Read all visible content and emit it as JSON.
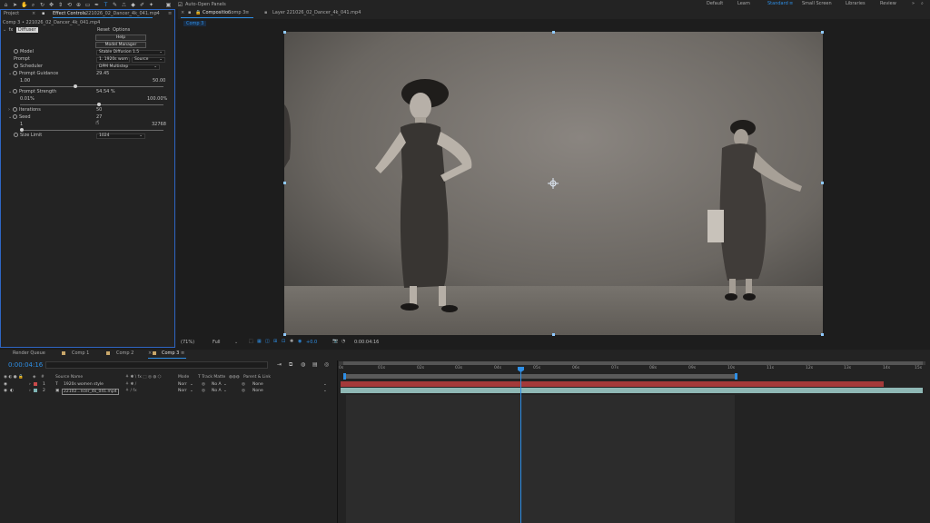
{
  "toolbar": {
    "auto_open": "Auto-Open Panels",
    "workspaces": [
      "Default",
      "Learn",
      "Standard",
      "Small Screen",
      "Libraries",
      "Review"
    ],
    "active_workspace": "Standard"
  },
  "left_panel": {
    "tab_project": "Project",
    "tab_effect": "Effect Controls",
    "tab_effect_file": "221026_02_Dancer_4k_041.mp4",
    "breadcrumb": "Comp 3 • 221026_02_Dancer_4k_041.mp4",
    "effect_name": "Diffuser",
    "reset": "Reset",
    "options": "Options",
    "help_btn": "Help",
    "model_manager_btn": "Model Manager",
    "params": {
      "model_label": "Model",
      "model_value": "Stable Diffusion 1.5",
      "prompt_label": "Prompt",
      "prompt_value": "1. 1920s wom",
      "prompt_source": "Source",
      "scheduler_label": "Scheduler",
      "scheduler_value": "DPM Multistep",
      "guidance_label": "Prompt Guidance",
      "guidance_value": "29.45",
      "guidance_min": "1.00",
      "guidance_max": "50.00",
      "strength_label": "Prompt Strength",
      "strength_value": "54.54 %",
      "strength_min": "0.01%",
      "strength_max": "100.00%",
      "iterations_label": "Iterations",
      "iterations_value": "50",
      "seed_label": "Seed",
      "seed_value": "27",
      "seed_min": "1",
      "seed_max": "32768",
      "size_label": "Size Limit",
      "size_value": "1024"
    }
  },
  "comp_panel": {
    "tab_comp": "Composition",
    "tab_comp_name": "Comp 3",
    "tab_layer": "Layer 221026_02_Dancer_4k_041.mp4",
    "subtab": "Comp 3",
    "zoom": "(71%)",
    "resolution": "Full",
    "exposure": "+0.0",
    "timecode": "0:00:04:16"
  },
  "timeline": {
    "tabs": [
      "Render Queue",
      "Comp 1",
      "Comp 2",
      "Comp 3"
    ],
    "active_tab": "Comp 3",
    "timecode": "0:00:04:16",
    "search_placeholder": "",
    "columns": {
      "source": "Source Name",
      "mode": "Mode",
      "track_matte": "T  Track Matte",
      "parent": "Parent & Link"
    },
    "layers": [
      {
        "num": "1",
        "type": "T",
        "name": "1920s women style",
        "mode": "Norr",
        "matte": "No A",
        "parent": "None",
        "color": "#c94a4a"
      },
      {
        "num": "2",
        "type": "",
        "name": "22102...ncer_4k_041.mp4",
        "mode": "Norr",
        "matte": "No A",
        "parent": "None",
        "color": "#7fb5b5"
      }
    ],
    "ruler": [
      "0s",
      "01s",
      "02s",
      "03s",
      "04s",
      "05s",
      "06s",
      "07s",
      "08s",
      "09s",
      "10s",
      "11s",
      "12s",
      "13s",
      "14s",
      "15s"
    ]
  },
  "colors": {
    "accent": "#2e8fe6",
    "text_layer_bar": "#a43a3a",
    "video_layer_bar": "#8fb8b5"
  }
}
